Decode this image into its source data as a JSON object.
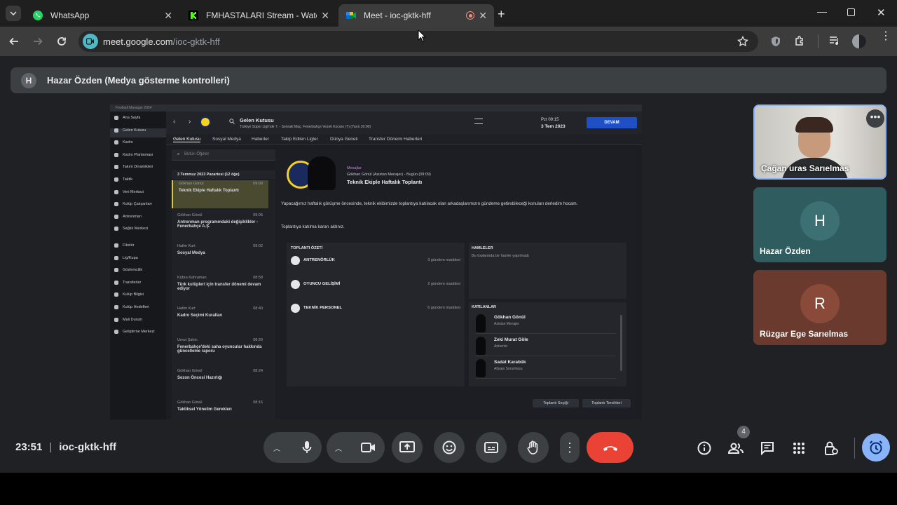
{
  "browser": {
    "tabs": [
      {
        "title": "WhatsApp",
        "icon": "whatsapp-icon"
      },
      {
        "title": "FMHASTALARI Stream - Watch",
        "icon": "kick-icon"
      },
      {
        "title": "Meet - ioc-gktk-hff",
        "icon": "meet-icon",
        "recording": true
      }
    ],
    "url_domain": "meet.google.com",
    "url_path": "/ioc-gktk-hff"
  },
  "banner": {
    "avatar_letter": "H",
    "text": "Hazar Özden (Medya gösterme kontrolleri)"
  },
  "shared_screen": {
    "app_title": "Football Manager 2024",
    "nav_items": [
      "Ana Sayfa",
      "Gelen Kutusu",
      "Kadro",
      "Kadro Planlaması",
      "Takım Dinamikleri",
      "Taktik",
      "Veri Merkezi",
      "Kulüp Çalışanları",
      "Antrenman",
      "Sağlık Merkezi",
      "Fikstür",
      "Lig/Kupa",
      "Gözlemcilik",
      "Transferler",
      "Kulüp Bilgisi",
      "Kulüp Hedefleri",
      "Mali Durum",
      "Geliştirme Merkezi"
    ],
    "header_title": "Gelen Kutusu",
    "header_sub": "Türkiye Süper Ligi'nde 7. - Sonraki Maç: Fenerbahçe Vezek Kocaro (T) (Yarın 20:00)",
    "date_day": "Pzt 09:15",
    "date": "3 Tem 2023",
    "continue_label": "DEVAM",
    "sub_tabs": [
      "Gelen Kutusu",
      "Sosyal Medya",
      "Haberler",
      "Takip Edilen Ligler",
      "Dünya Geneli",
      "Transfer Dönemi Haberleri"
    ],
    "search_placeholder": "Bütün Öğeler",
    "inbox_group": "3 Temmuz 2023 Pazartesi (12 öğe)",
    "messages": [
      {
        "from": "Gökhan Gönül",
        "time": "09:09",
        "subject": "Teknik Ekiple Haftalık Toplantı",
        "selected": true
      },
      {
        "from": "Gökhan Gönül",
        "time": "09:05",
        "subject": "Antrenman programındaki değişiklikler - Fenerbahçe A.Ş."
      },
      {
        "from": "Halim Kurt",
        "time": "09:02",
        "subject": "Sosyal Medya"
      },
      {
        "from": "Kübra Kahraman",
        "time": "08:58",
        "subject": "Türk kulüpleri için transfer dönemi devam ediyor"
      },
      {
        "from": "Halim Kurt",
        "time": "08:40",
        "subject": "Kadro Seçimi Kuralları"
      },
      {
        "from": "Umut Şahin",
        "time": "08:29",
        "subject": "Fenerbahçe'deki saha oyuncular hakkında güncelleme raporu"
      },
      {
        "from": "Gökhan Gönül",
        "time": "08:24",
        "subject": "Sezon Öncesi Hazırlığı"
      },
      {
        "from": "Gökhan Gönül",
        "time": "08:16",
        "subject": "Taktiksel Yönelim Gereklerı"
      }
    ],
    "detail": {
      "category": "Mesajlar",
      "sender": "Gökhan Gönül (Asistan Menajer)",
      "when": "Bugün (09:09)",
      "title": "Teknik Ekiple Haftalık Toplantı",
      "body1": "Yapacağımız haftalık görüşme öncesinde, teknik ekibimizde toplantıya katılacak olan arkadaşlarımızın gündeme getirebileceği konuları derledim hocam.",
      "body2": "Toplantıya katılma kararı aldınız.",
      "summary_title": "TOPLANTI ÖZETİ",
      "summary": [
        {
          "label": "ANTRENÖRLÜK",
          "count": "3 gündem maddesi"
        },
        {
          "label": "OYUNCU GELİŞİMİ",
          "count": "2 gündem maddesi"
        },
        {
          "label": "TEKNİK PERSONEL",
          "count": "6 gündem maddesi"
        }
      ],
      "moves_title": "HAMLELER",
      "moves_text": "Bu toplantıda bir hamle yapılmadı",
      "attendees_title": "KATILANLAR",
      "attendees": [
        {
          "name": "Gökhan Gönül",
          "role": "Asistan Menajer"
        },
        {
          "name": "Zeki Murat Göle",
          "role": "Antrenör"
        },
        {
          "name": "Sadat Karabük",
          "role": "Altyapı Sorumlusu"
        }
      ],
      "btn_meeting": "Toplantı Seçiği",
      "btn_prefs": "Toplantı Tercihleri"
    }
  },
  "participants": [
    {
      "name": "Çağan uras Sarıelmas",
      "video": true
    },
    {
      "name": "Hazar Özden",
      "letter": "H",
      "color": "#2f5d5f",
      "avatar_color": "#3d7073"
    },
    {
      "name": "Rüzgar Ege Sarıelmas",
      "letter": "R",
      "color": "#6b3a2e",
      "avatar_color": "#8a4a3a"
    }
  ],
  "meeting": {
    "time": "23:51",
    "code": "ioc-gktk-hff",
    "people_count": "4"
  }
}
